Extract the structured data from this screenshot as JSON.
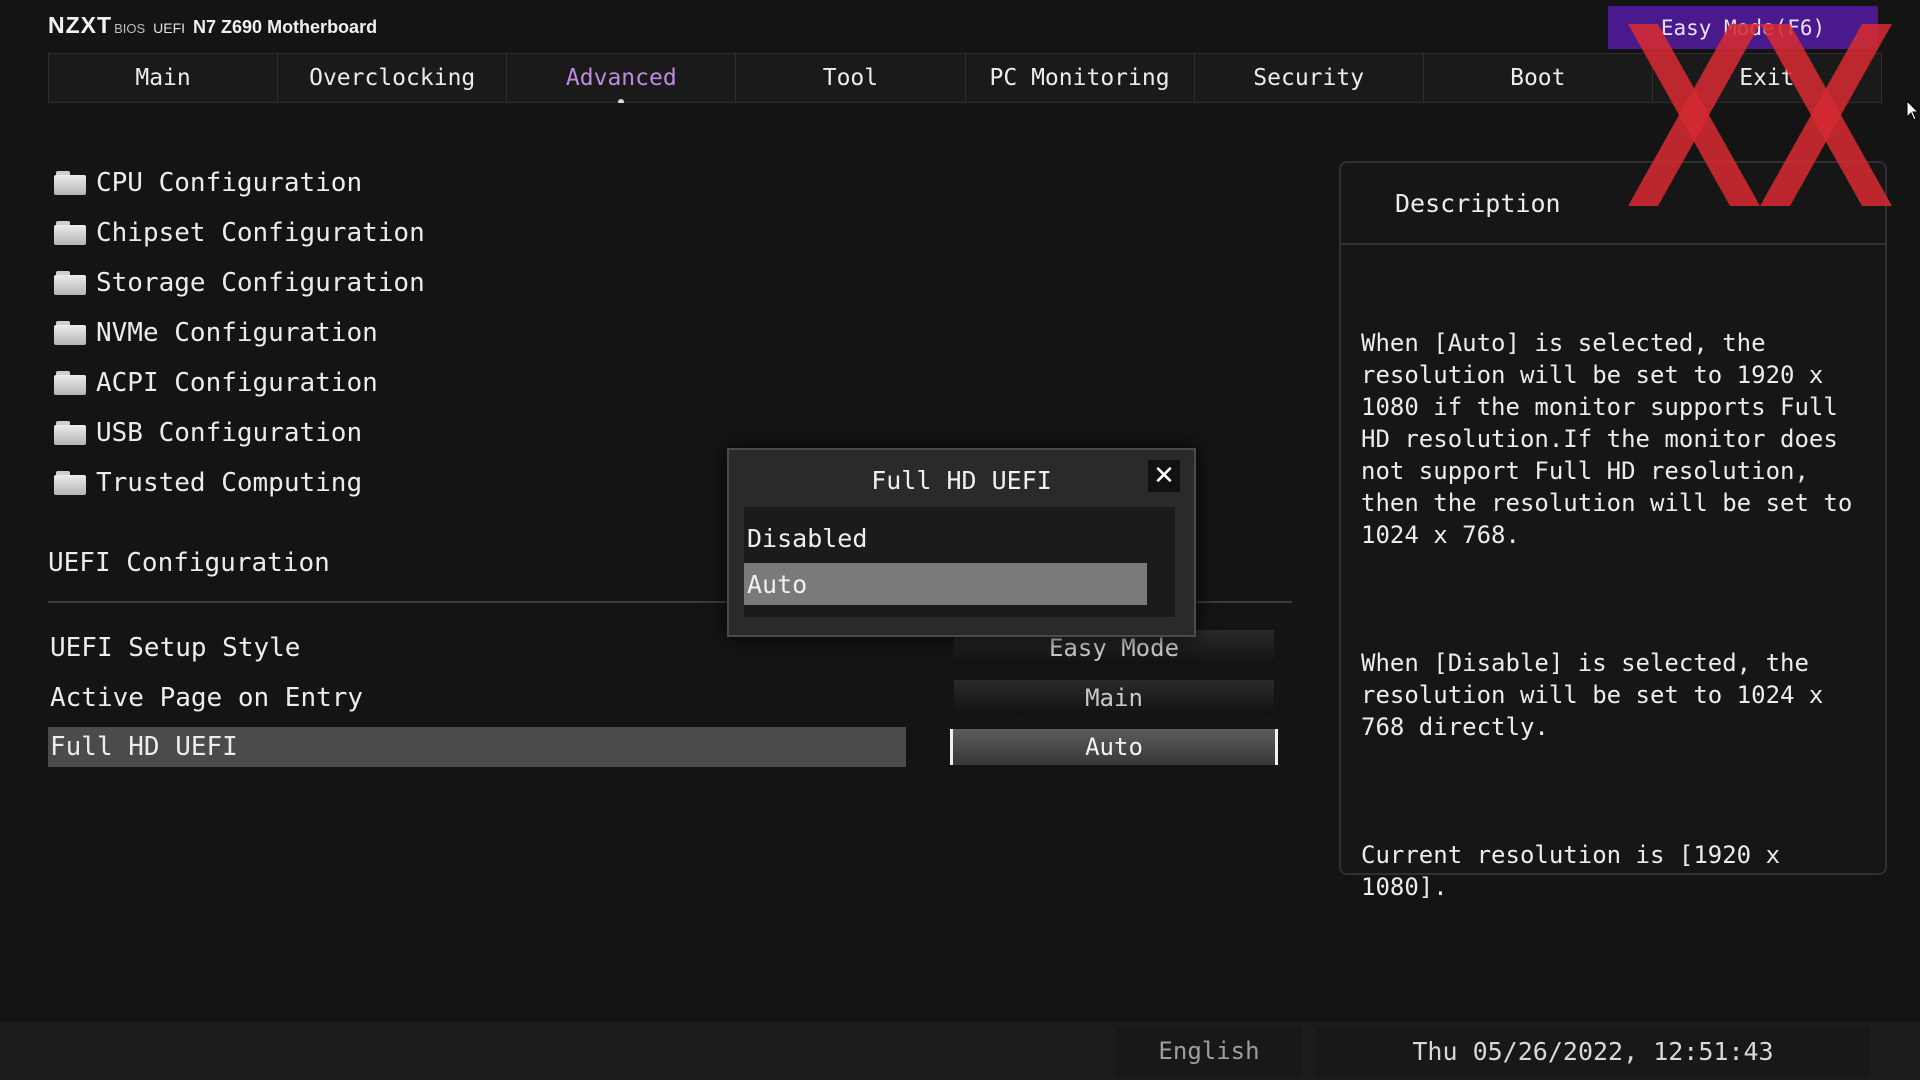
{
  "header": {
    "logo": "NZXT",
    "bios": "BIOS",
    "uefi": "UEFI",
    "model": "N7 Z690 Motherboard",
    "easy_mode_button": "Easy Mode(F6)"
  },
  "tabs": [
    {
      "label": "Main"
    },
    {
      "label": "Overclocking"
    },
    {
      "label": "Advanced",
      "active": true
    },
    {
      "label": "Tool"
    },
    {
      "label": "PC Monitoring"
    },
    {
      "label": "Security"
    },
    {
      "label": "Boot"
    },
    {
      "label": "Exit"
    }
  ],
  "submenus": [
    {
      "label": "CPU Configuration",
      "icon": "folder-icon"
    },
    {
      "label": "Chipset Configuration",
      "icon": "folder-icon"
    },
    {
      "label": "Storage Configuration",
      "icon": "folder-icon"
    },
    {
      "label": "NVMe Configuration",
      "icon": "folder-icon"
    },
    {
      "label": "ACPI Configuration",
      "icon": "folder-icon"
    },
    {
      "label": "USB Configuration",
      "icon": "folder-icon"
    },
    {
      "label": "Trusted Computing",
      "icon": "folder-icon"
    }
  ],
  "uefi_section": {
    "title": "UEFI Configuration",
    "settings": [
      {
        "label": "UEFI Setup Style",
        "value": "Easy Mode"
      },
      {
        "label": "Active Page on Entry",
        "value": "Main"
      },
      {
        "label": "Full HD UEFI",
        "value": "Auto",
        "selected": true
      }
    ]
  },
  "description": {
    "title": "Description",
    "paragraphs": [
      "When [Auto] is selected, the resolution will be set to 1920 x 1080 if the monitor supports Full HD resolution.If the monitor does not support Full HD resolution, then the resolution will be set to 1024 x 768.",
      "When [Disable] is selected, the resolution will be set to 1024 x 768 directly.",
      "Current resolution is [1920 x 1080]."
    ]
  },
  "modal": {
    "title": "Full HD UEFI",
    "close_icon": "close-icon",
    "options": [
      {
        "label": "Disabled"
      },
      {
        "label": "Auto",
        "selected": true
      }
    ]
  },
  "footer": {
    "language": "English",
    "datetime": "Thu 05/26/2022, 12:51:43"
  },
  "colors": {
    "accent_active_tab": "#c08adf",
    "easy_mode_button": "#4a1a8c",
    "watermark": "#d42a32"
  }
}
